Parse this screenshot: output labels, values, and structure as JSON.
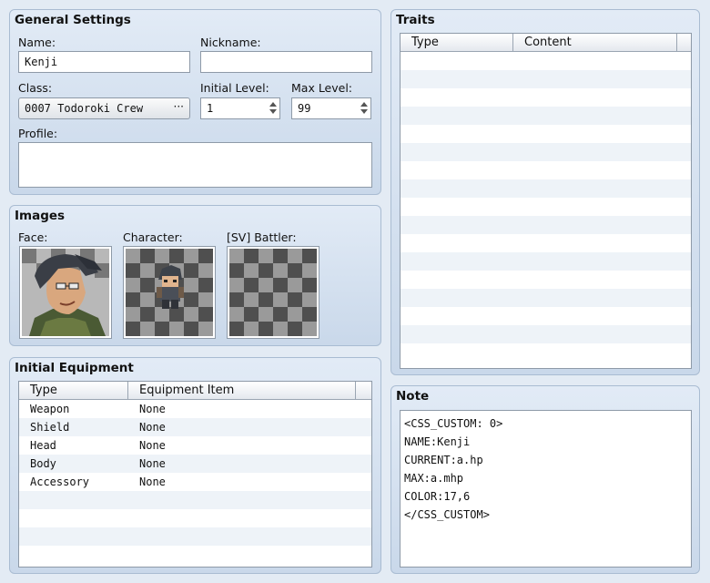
{
  "general": {
    "title": "General Settings",
    "name_label": "Name:",
    "name_value": "Kenji",
    "nickname_label": "Nickname:",
    "nickname_value": "",
    "class_label": "Class:",
    "class_value": "0007 Todoroki Crew",
    "class_button": "···",
    "initial_level_label": "Initial Level:",
    "initial_level_value": "1",
    "max_level_label": "Max Level:",
    "max_level_value": "99",
    "profile_label": "Profile:",
    "profile_value": ""
  },
  "images": {
    "title": "Images",
    "face_label": "Face:",
    "character_label": "Character:",
    "battler_label": "[SV] Battler:"
  },
  "equipment": {
    "title": "Initial Equipment",
    "col_type": "Type",
    "col_item": "Equipment Item",
    "rows": [
      {
        "type": "Weapon",
        "item": "None"
      },
      {
        "type": "Shield",
        "item": "None"
      },
      {
        "type": "Head",
        "item": "None"
      },
      {
        "type": "Body",
        "item": "None"
      },
      {
        "type": "Accessory",
        "item": "None"
      }
    ]
  },
  "traits": {
    "title": "Traits",
    "col_type": "Type",
    "col_content": "Content"
  },
  "note": {
    "title": "Note",
    "text": "<CSS_CUSTOM: 0>\nNAME:Kenji\nCURRENT:a.hp\nMAX:a.mhp\nCOLOR:17,6\n</CSS_CUSTOM>"
  }
}
